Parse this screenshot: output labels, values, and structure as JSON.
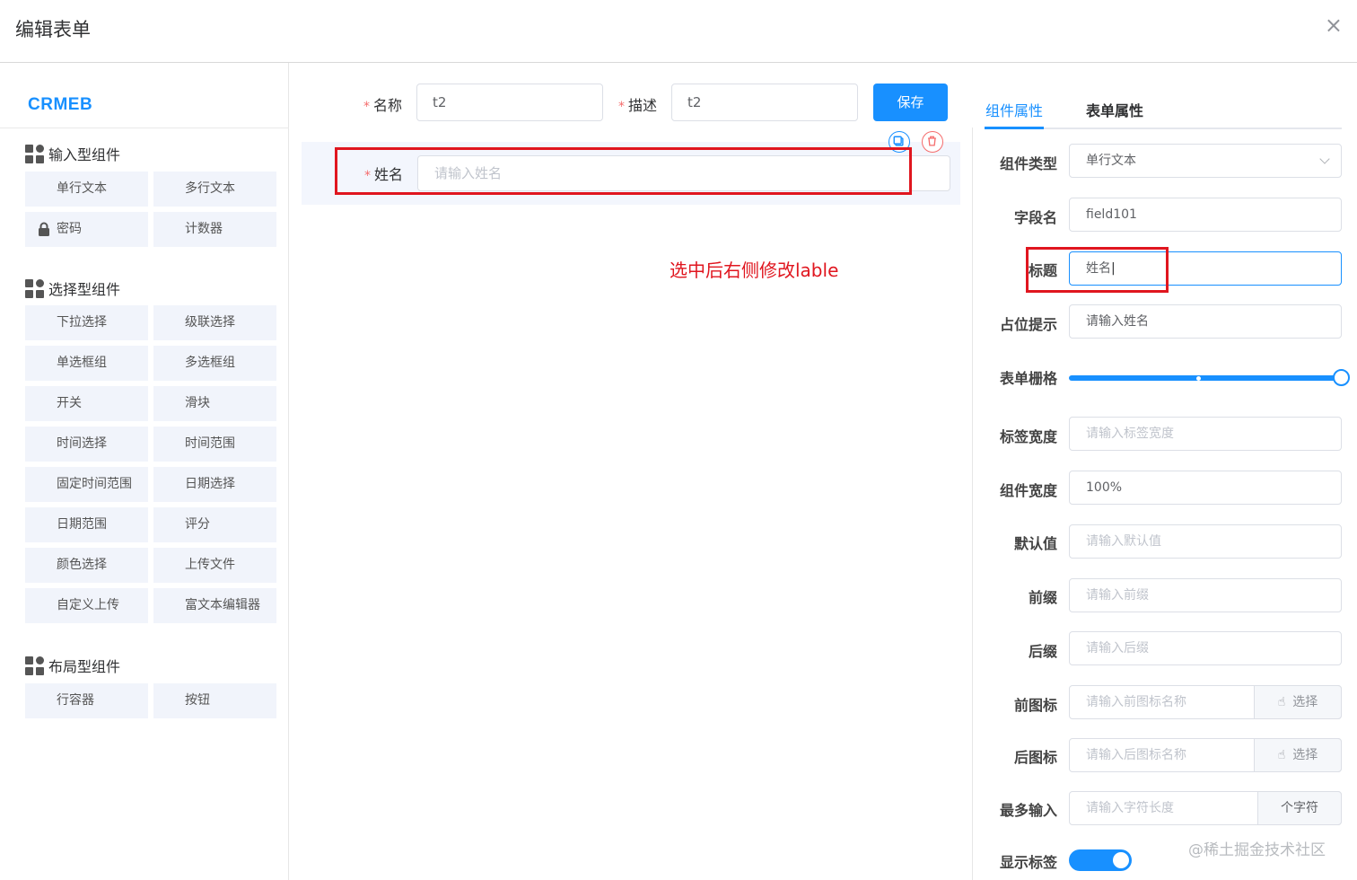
{
  "dialog": {
    "title": "编辑表单",
    "close_icon": "×"
  },
  "left": {
    "logo": "CRMEB",
    "groups": [
      {
        "title": "输入型组件",
        "items": [
          "单行文本",
          "多行文本",
          "密码",
          "计数器"
        ]
      },
      {
        "title": "选择型组件",
        "items": [
          "下拉选择",
          "级联选择",
          "单选框组",
          "多选框组",
          "开关",
          "滑块",
          "时间选择",
          "时间范围",
          "固定时间范围",
          "日期选择",
          "日期范围",
          "评分",
          "颜色选择",
          "上传文件",
          "自定义上传",
          "富文本编辑器"
        ]
      },
      {
        "title": "布局型组件",
        "items": [
          "行容器",
          "按钮"
        ]
      }
    ]
  },
  "toolbar": {
    "name_label": "名称",
    "name_value": "t2",
    "desc_label": "描述",
    "desc_value": "t2",
    "save_label": "保存"
  },
  "canvas": {
    "field_label": "姓名",
    "field_placeholder": "请输入姓名",
    "annotation": "选中后右侧修改lable"
  },
  "right": {
    "tabs": [
      "组件属性",
      "表单属性"
    ],
    "active_tab": 0,
    "props": {
      "type_label": "组件类型",
      "type_value": "单行文本",
      "field_label": "字段名",
      "field_value": "field101",
      "title_label": "标题",
      "title_value": "姓名",
      "placeholder_label": "占位提示",
      "placeholder_value": "请输入姓名",
      "grid_label": "表单栅格",
      "grid_value": 24,
      "label_width_label": "标签宽度",
      "label_width_ph": "请输入标签宽度",
      "comp_width_label": "组件宽度",
      "comp_width_value": "100%",
      "default_label": "默认值",
      "default_ph": "请输入默认值",
      "prefix_label": "前缀",
      "prefix_ph": "请输入前缀",
      "suffix_label": "后缀",
      "suffix_ph": "请输入后缀",
      "prefix_icon_label": "前图标",
      "prefix_icon_ph": "请输入前图标名称",
      "suffix_icon_label": "后图标",
      "suffix_icon_ph": "请输入后图标名称",
      "select_label": "选择",
      "maxlen_label": "最多输入",
      "maxlen_ph": "请输入字符长度",
      "maxlen_unit": "个字符",
      "show_label_label": "显示标签",
      "show_label_on": true
    }
  },
  "watermark": "@稀土掘金技术社区",
  "colors": {
    "primary": "#1890ff",
    "annotation": "#e0161f"
  }
}
